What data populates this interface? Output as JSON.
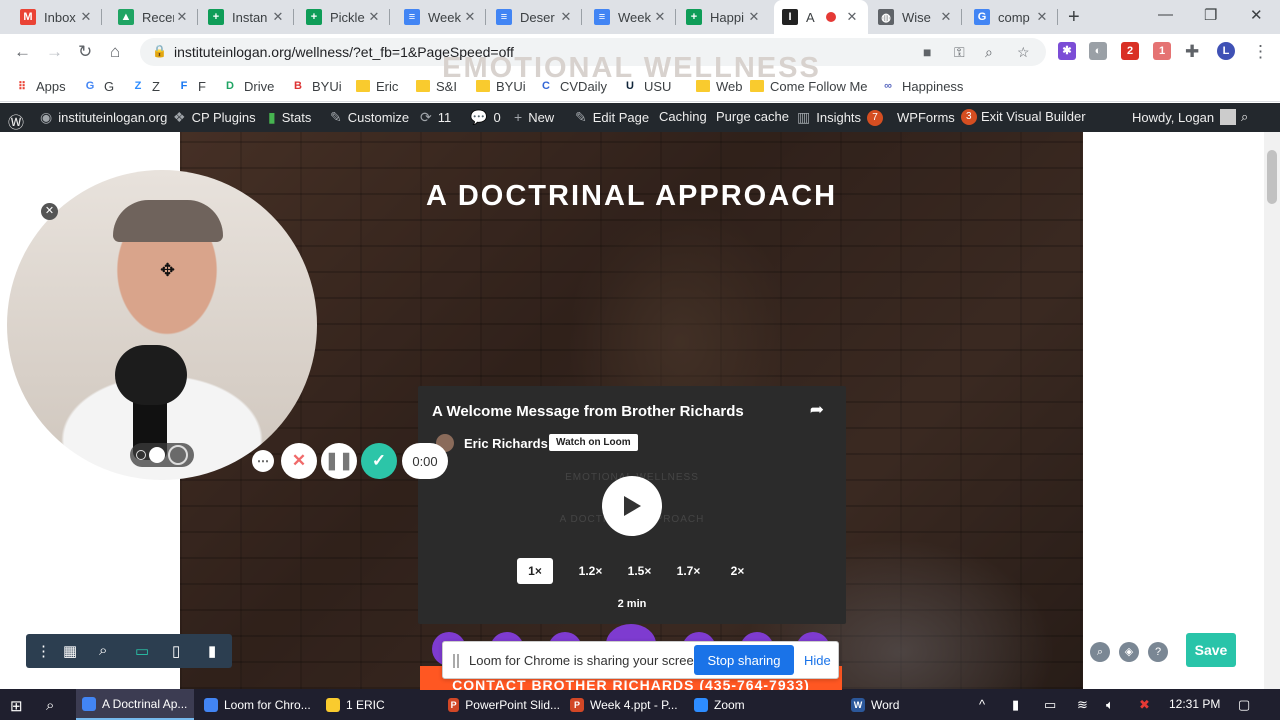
{
  "tabs": [
    {
      "title": "Inbox",
      "icon": "gmail-icon",
      "color": "#ea4335",
      "glyph": "M"
    },
    {
      "title": "Recen",
      "icon": "drive-icon",
      "color": "#1fa463",
      "glyph": "▲"
    },
    {
      "title": "Instan",
      "icon": "sheets-icon",
      "color": "#0f9d58",
      "glyph": "+"
    },
    {
      "title": "Pickle",
      "icon": "sheets-icon",
      "color": "#0f9d58",
      "glyph": "+"
    },
    {
      "title": "Week",
      "icon": "docs-icon",
      "color": "#4285f4",
      "glyph": "≡"
    },
    {
      "title": "Deser",
      "icon": "docs-icon",
      "color": "#4285f4",
      "glyph": "≡"
    },
    {
      "title": "Week",
      "icon": "docs-icon",
      "color": "#4285f4",
      "glyph": "≡"
    },
    {
      "title": "Happi",
      "icon": "sheets-icon",
      "color": "#0f9d58",
      "glyph": "+"
    },
    {
      "title": "A",
      "icon": "site-icon",
      "color": "#222222",
      "glyph": "I"
    },
    {
      "title": "Wise",
      "icon": "globe-icon",
      "color": "#5f6368",
      "glyph": "◍"
    },
    {
      "title": "comp",
      "icon": "google-icon",
      "color": "#4285f4",
      "glyph": "G"
    }
  ],
  "toolbar": {
    "url": "instituteinlogan.org/wellness/?et_fb=1&PageSpeed=off"
  },
  "bookmarks": [
    {
      "label": "Apps",
      "icon": "apps-grid-icon",
      "color": "#ea4335"
    },
    {
      "label": "G",
      "icon": "google-icon",
      "color": "#4285f4"
    },
    {
      "label": "Z",
      "icon": "zoom-icon",
      "color": "#2d8cff"
    },
    {
      "label": "F",
      "icon": "facebook-icon",
      "color": "#1877f2"
    },
    {
      "label": "Drive",
      "icon": "drive-icon",
      "color": "#1fa463"
    },
    {
      "label": "BYUi",
      "icon": "byui-icon",
      "color": "#d33"
    },
    {
      "label": "Eric",
      "icon": "folder-icon",
      "color": "#f9cb2e"
    },
    {
      "label": "S&I",
      "icon": "folder-icon",
      "color": "#f9cb2e"
    },
    {
      "label": "BYUi",
      "icon": "folder-icon",
      "color": "#f9cb2e"
    },
    {
      "label": "CVDaily",
      "icon": "cvdaily-icon",
      "color": "#3367d6"
    },
    {
      "label": "USU",
      "icon": "usu-icon",
      "color": "#0f2439"
    },
    {
      "label": "Web",
      "icon": "folder-icon",
      "color": "#f9cb2e"
    },
    {
      "label": "Come Follow Me",
      "icon": "folder-icon",
      "color": "#f9cb2e"
    },
    {
      "label": "Happiness",
      "icon": "link-icon",
      "color": "#5c6bc0"
    }
  ],
  "wpbar": {
    "site": "instituteinlogan.org",
    "cp_plugins": "CP Plugins",
    "stats": "Stats",
    "customize": "Customize",
    "updates": "11",
    "comments": "0",
    "new": "New",
    "edit_page": "Edit Page",
    "caching": "Caching",
    "purge": "Purge cache",
    "insights": "Insights",
    "insights_badge": "7",
    "wpforms": "WPForms",
    "wpforms_badge": "3",
    "exit": "Exit Visual Builder",
    "howdy": "Howdy, Logan"
  },
  "page": {
    "section_title": "EMOTIONAL WELLNESS",
    "main_title": "A DOCTRINAL APPROACH",
    "contact": "CONTACT BROTHER RICHARDS (435-764-7933)"
  },
  "embed": {
    "title": "A Welcome Message from Brother Richards",
    "author": "Eric Richards",
    "watch": "Watch on Loom",
    "ghost1": "EMOTIONAL WELLNESS",
    "ghost2": "A DOCTRINAL APPROACH",
    "speeds": [
      "1×",
      "1.2×",
      "1.5×",
      "1.7×",
      "2×"
    ],
    "duration": "2 min"
  },
  "loom": {
    "timer": "0:00"
  },
  "share_notice": {
    "message": "Loom for Chrome is sharing your screen.",
    "stop": "Stop sharing",
    "hide": "Hide"
  },
  "builder": {
    "save": "Save"
  },
  "taskbar": {
    "items": [
      {
        "label": "A Doctrinal Ap...",
        "icon": "chrome-icon",
        "color": "#4285f4"
      },
      {
        "label": "Loom for Chro...",
        "icon": "chrome-icon",
        "color": "#4285f4"
      },
      {
        "label": "1 ERIC",
        "icon": "folder-icon",
        "color": "#f9cb2e"
      },
      {
        "label": "PowerPoint Slid...",
        "icon": "powerpoint-icon",
        "color": "#d24726"
      },
      {
        "label": "Week 4.ppt - P...",
        "icon": "powerpoint-icon",
        "color": "#d24726"
      },
      {
        "label": "Zoom",
        "icon": "zoom-icon",
        "color": "#2d8cff"
      },
      {
        "label": "Word",
        "icon": "word-icon",
        "color": "#2b579a"
      }
    ],
    "clock": "12:31 PM"
  }
}
